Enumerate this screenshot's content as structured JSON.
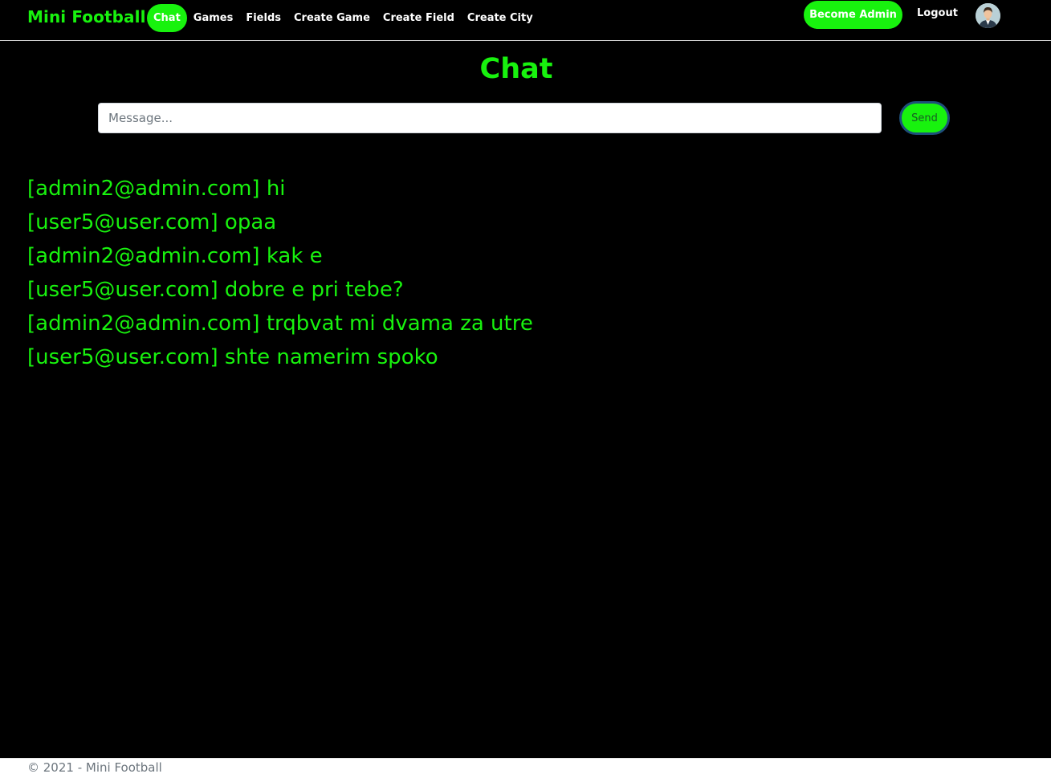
{
  "navbar": {
    "brand": "Mini Football",
    "links": [
      {
        "label": "Chat",
        "active": true
      },
      {
        "label": "Games",
        "active": false
      },
      {
        "label": "Fields",
        "active": false
      },
      {
        "label": "Create Game",
        "active": false
      },
      {
        "label": "Create Field",
        "active": false
      },
      {
        "label": "Create City",
        "active": false
      }
    ],
    "become_admin_label": "Become Admin",
    "logout_label": "Logout",
    "avatar_icon": "user-avatar-icon"
  },
  "main": {
    "title": "Chat",
    "message_input": {
      "placeholder": "Message...",
      "value": ""
    },
    "send_label": "Send",
    "messages": [
      "[admin2@admin.com] hi",
      "[user5@user.com] opaa",
      "[admin2@admin.com] kak e",
      "[user5@user.com] dobre e pri tebe?",
      "[admin2@admin.com] trqbvat mi dvama za utre",
      "[user5@user.com] shte namerim spoko"
    ]
  },
  "footer": {
    "text": "© 2021 - Mini Football"
  },
  "colors": {
    "accent": "#18f20e",
    "background": "#000000",
    "send_border": "#1d4f7a"
  }
}
